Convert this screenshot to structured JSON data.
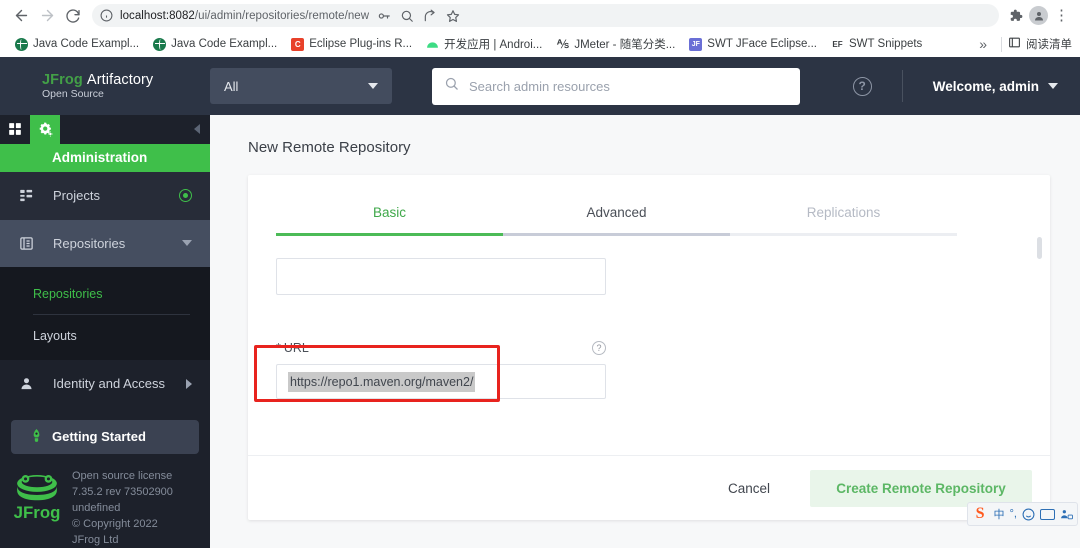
{
  "browser": {
    "back_icon": "back-arrow-icon",
    "forward_icon": "forward-arrow-icon",
    "reload_icon": "reload-icon",
    "url_host": "localhost:8082",
    "url_path": "/ui/admin/repositories/remote/new",
    "url_full": "localhost:8082/ui/admin/repositories/remote/new",
    "omni_icons": [
      "key-icon",
      "zoom-icon",
      "share-icon",
      "bookmark-star-icon"
    ],
    "right_icons": [
      "extensions-puzzle-icon",
      "profile-avatar-icon",
      "chrome-menu-kebab-icon"
    ],
    "bookmarks": [
      {
        "label": "Java Code Exampl...",
        "icon": "globe-favicon",
        "glyph": ""
      },
      {
        "label": "Java Code Exampl...",
        "icon": "globe-favicon",
        "glyph": ""
      },
      {
        "label": "Eclipse Plug-ins R...",
        "icon": "c-favicon",
        "glyph": "C"
      },
      {
        "label": "开发应用 | Androi...",
        "icon": "android-favicon",
        "glyph": "▰"
      },
      {
        "label": "JMeter - 随笔分类...",
        "icon": "jmeter-favicon",
        "glyph": "⅍"
      },
      {
        "label": "SWT JFace Eclipse...",
        "icon": "swt-favicon",
        "glyph": "JF"
      },
      {
        "label": "SWT Snippets",
        "icon": "ef-favicon",
        "glyph": "EF"
      }
    ],
    "overflow_label": "»",
    "reading_list_label": "阅读清单",
    "reading_list_icon": "reading-list-icon"
  },
  "header": {
    "logo_jfrog": "JFrog",
    "logo_artifactory": "Artifactory",
    "logo_edition": "Open Source",
    "scope_selected": "All",
    "scope_caret_icon": "chevron-down-icon",
    "search_placeholder": "Search admin resources",
    "search_icon": "search-icon",
    "help_label": "?",
    "welcome_label": "Welcome, admin",
    "welcome_caret_icon": "chevron-down-icon"
  },
  "sidebar": {
    "tabs": [
      {
        "name": "apps-grid-tab",
        "icon": "grid-apps-icon",
        "active": false
      },
      {
        "name": "administration-tab",
        "icon": "gears-icon",
        "active": true
      }
    ],
    "collapse_icon": "collapse-left-chevron-icon",
    "section_title": "Administration",
    "items": [
      {
        "label": "Projects",
        "icon": "projects-hierarchy-icon",
        "trailing": "target-dot-icon"
      },
      {
        "label": "Repositories",
        "icon": "repositories-list-icon",
        "trailing": "chevron-down-icon"
      }
    ],
    "submenu": [
      {
        "label": "Repositories",
        "active": true
      },
      {
        "label": "Layouts",
        "active": false
      }
    ],
    "identity": {
      "label": "Identity and Access",
      "icon": "user-icon",
      "trailing": "chevron-right-icon"
    },
    "getting_started": {
      "label": "Getting Started",
      "icon": "rocket-icon"
    },
    "footer": {
      "logo_icon": "jfrog-frog-logo",
      "line1": "Open source license",
      "line2": "7.35.2 rev 73502900",
      "line3": "undefined",
      "line4": "© Copyright 2022",
      "line5": "JFrog Ltd"
    }
  },
  "main": {
    "page_title": "New Remote Repository",
    "tabs": [
      {
        "label": "Basic",
        "state": "active"
      },
      {
        "label": "Advanced",
        "state": "normal"
      },
      {
        "label": "Replications",
        "state": "disabled"
      }
    ],
    "key_field": {
      "value": "",
      "placeholder": ""
    },
    "url_field": {
      "required_mark": "*",
      "label": "URL",
      "help_icon": "question-mark-icon",
      "value": "https://repo1.maven.org/maven2/"
    },
    "annotation": {
      "name": "red-highlight-box",
      "color": "#e8231e"
    },
    "scrollbar": "card-scrollbar-thumb",
    "footer": {
      "cancel_label": "Cancel",
      "create_label": "Create Remote Repository"
    }
  },
  "ime": {
    "logo": "sogou-s-icon",
    "mode_label": "中",
    "punct_label": "°,",
    "emoji_icon": "smiley-icon",
    "keyboard_icon": "keyboard-icon",
    "toolbox_icon": "ime-toolbox-icon"
  },
  "colors": {
    "brand_green": "#3fbf4a",
    "header_dark": "#2c3444",
    "sidebar_dark": "#1d212b",
    "annotation_red": "#e8231e",
    "page_bg": "#f7f8f9"
  }
}
